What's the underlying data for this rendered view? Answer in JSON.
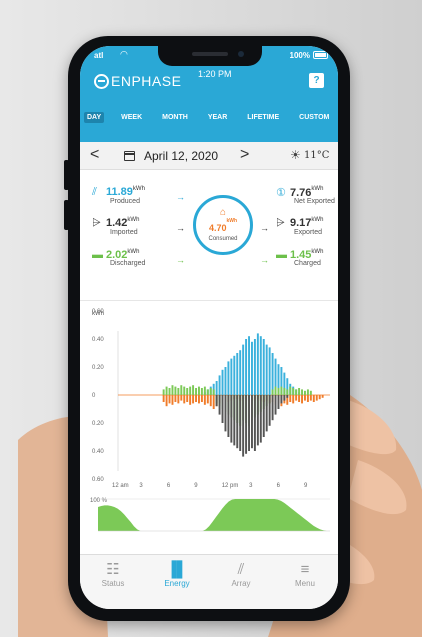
{
  "status_bar": {
    "signal": "atl",
    "battery": "100%"
  },
  "header": {
    "brand": "ENPHASE",
    "time": "1:20 PM",
    "help_label": "?"
  },
  "tabs": [
    {
      "label": "DAY",
      "active": true
    },
    {
      "label": "WEEK",
      "active": false
    },
    {
      "label": "MONTH",
      "active": false
    },
    {
      "label": "YEAR",
      "active": false
    },
    {
      "label": "LIFETIME",
      "active": false
    },
    {
      "label": "CUSTOM",
      "active": false
    }
  ],
  "date_row": {
    "prev_label": "<",
    "date": "April 12, 2020",
    "next_label": ">",
    "temperature": "11°C"
  },
  "flow": {
    "produced": {
      "value": "11.89",
      "unit": "kWh",
      "label": "Produced"
    },
    "imported": {
      "value": "1.42",
      "unit": "kWh",
      "label": "Imported"
    },
    "discharged": {
      "value": "2.02",
      "unit": "kWh",
      "label": "Discharged"
    },
    "consumed": {
      "value": "4.70",
      "unit": "kWh",
      "label": "Consumed"
    },
    "net_exported": {
      "value": "7.76",
      "unit": "kWh",
      "label": "Net Exported"
    },
    "exported": {
      "value": "9.17",
      "unit": "kWh",
      "label": "Exported"
    },
    "charged": {
      "value": "1.45",
      "unit": "kWh",
      "label": "Charged"
    }
  },
  "chart_data": {
    "type": "bar",
    "ylabel": "kWh",
    "yticks_pos": [
      "0.60",
      "0.40",
      "0.20",
      "0"
    ],
    "yticks_neg": [
      "0.20",
      "0.40",
      "0.60"
    ],
    "ylim": [
      -0.6,
      0.6
    ],
    "xticks": [
      "12 am",
      "3",
      "6",
      "9",
      "12 pm",
      "3",
      "6",
      "9"
    ],
    "colors": {
      "produced": "#3bb1dc",
      "consumed": "#f07c2a",
      "charge": "#7cc957",
      "export": "#555555"
    },
    "series": [
      {
        "name": "Produced",
        "color": "#3bb1dc",
        "values": [
          0,
          0,
          0,
          0,
          0,
          0,
          0,
          0,
          0,
          0,
          0,
          0,
          0,
          0,
          0,
          0,
          0,
          0,
          0,
          0,
          0,
          0,
          0,
          0,
          0,
          0,
          0,
          0,
          0,
          0.02,
          0.04,
          0.06,
          0.08,
          0.1,
          0.14,
          0.18,
          0.2,
          0.24,
          0.26,
          0.28,
          0.3,
          0.32,
          0.36,
          0.4,
          0.42,
          0.38,
          0.4,
          0.44,
          0.42,
          0.4,
          0.36,
          0.34,
          0.3,
          0.26,
          0.22,
          0.2,
          0.16,
          0.12,
          0.08,
          0.06,
          0.04,
          0.02,
          0,
          0,
          0,
          0,
          0,
          0,
          0,
          0,
          0,
          0
        ]
      },
      {
        "name": "Consumed",
        "color": "#f07c2a",
        "values": [
          0,
          0,
          0,
          0,
          0,
          0,
          0,
          0,
          0,
          0,
          0,
          0,
          0,
          0,
          0,
          -0.05,
          -0.08,
          -0.06,
          -0.07,
          -0.05,
          -0.06,
          -0.04,
          -0.06,
          -0.05,
          -0.07,
          -0.06,
          -0.05,
          -0.06,
          -0.05,
          -0.07,
          -0.06,
          -0.08,
          -0.1,
          -0.08,
          -0.06,
          -0.05,
          -0.04,
          -0.05,
          -0.04,
          -0.03,
          -0.03,
          -0.04,
          -0.03,
          -0.04,
          -0.03,
          -0.05,
          -0.04,
          -0.03,
          -0.04,
          -0.05,
          -0.04,
          -0.06,
          -0.05,
          -0.07,
          -0.06,
          -0.08,
          -0.06,
          -0.07,
          -0.05,
          -0.06,
          -0.04,
          -0.05,
          -0.06,
          -0.04,
          -0.05,
          -0.04,
          -0.05,
          -0.04,
          -0.03,
          -0.02,
          0,
          0
        ]
      },
      {
        "name": "Charge",
        "color": "#7cc957",
        "values": [
          0,
          0,
          0,
          0,
          0,
          0,
          0,
          0,
          0,
          0,
          0,
          0,
          0,
          0,
          0,
          0.04,
          0.06,
          0.05,
          0.07,
          0.06,
          0.05,
          0.07,
          0.06,
          0.05,
          0.06,
          0.07,
          0.05,
          0.06,
          0.05,
          0.06,
          0.04,
          0.05,
          0.04,
          -0.06,
          -0.08,
          -0.1,
          -0.12,
          -0.14,
          -0.16,
          -0.18,
          -0.2,
          -0.22,
          -0.18,
          -0.2,
          -0.22,
          -0.18,
          -0.16,
          -0.14,
          -0.12,
          -0.1,
          -0.08,
          -0.06,
          0.04,
          0.06,
          0.05,
          0.06,
          0.05,
          0.04,
          0.06,
          0.05,
          0.04,
          0.05,
          0.04,
          0.03,
          0.04,
          0.03,
          0,
          0,
          0,
          0,
          0,
          0
        ]
      },
      {
        "name": "Export",
        "color": "#555555",
        "values": [
          0,
          0,
          0,
          0,
          0,
          0,
          0,
          0,
          0,
          0,
          0,
          0,
          0,
          0,
          0,
          0,
          0,
          0,
          0,
          0,
          0,
          0,
          0,
          0,
          0,
          0,
          0,
          0,
          0,
          0,
          0,
          0,
          0,
          -0.08,
          -0.14,
          -0.2,
          -0.26,
          -0.3,
          -0.34,
          -0.36,
          -0.38,
          -0.4,
          -0.44,
          -0.42,
          -0.4,
          -0.38,
          -0.4,
          -0.36,
          -0.34,
          -0.3,
          -0.26,
          -0.22,
          -0.18,
          -0.14,
          -0.1,
          -0.06,
          -0.04,
          -0.02,
          0,
          0,
          0,
          0,
          0,
          0,
          0,
          0,
          0,
          0,
          0,
          0,
          0,
          0
        ]
      }
    ],
    "battery_soc": {
      "ylabel": "100 %",
      "values": [
        0.75,
        0.78,
        0.8,
        0.8,
        0.78,
        0.75,
        0.7,
        0.62,
        0.52,
        0.4,
        0.28,
        0.15,
        0.05,
        0,
        0,
        0,
        0,
        0,
        0,
        0,
        0,
        0,
        0,
        0,
        0,
        0,
        0,
        0,
        0,
        0,
        0,
        0,
        0,
        0.05,
        0.15,
        0.28,
        0.42,
        0.56,
        0.7,
        0.82,
        0.92,
        0.98,
        1.0,
        1.0,
        1.0,
        1.0,
        1.0,
        1.0,
        1.0,
        1.0,
        1.0,
        1.0,
        1.0,
        1.0,
        1.0,
        0.98,
        0.94,
        0.88,
        0.8,
        0.72,
        0.64,
        0.56,
        0.48,
        0.4,
        0.32,
        0.24,
        0.16,
        0.1,
        0.05,
        0.02,
        0,
        0
      ]
    }
  },
  "bottom_nav": [
    {
      "label": "Status",
      "icon": "grid-icon",
      "active": false
    },
    {
      "label": "Energy",
      "icon": "bar-chart-icon",
      "active": true
    },
    {
      "label": "Array",
      "icon": "solar-array-icon",
      "active": false
    },
    {
      "label": "Menu",
      "icon": "menu-icon",
      "active": false
    }
  ]
}
